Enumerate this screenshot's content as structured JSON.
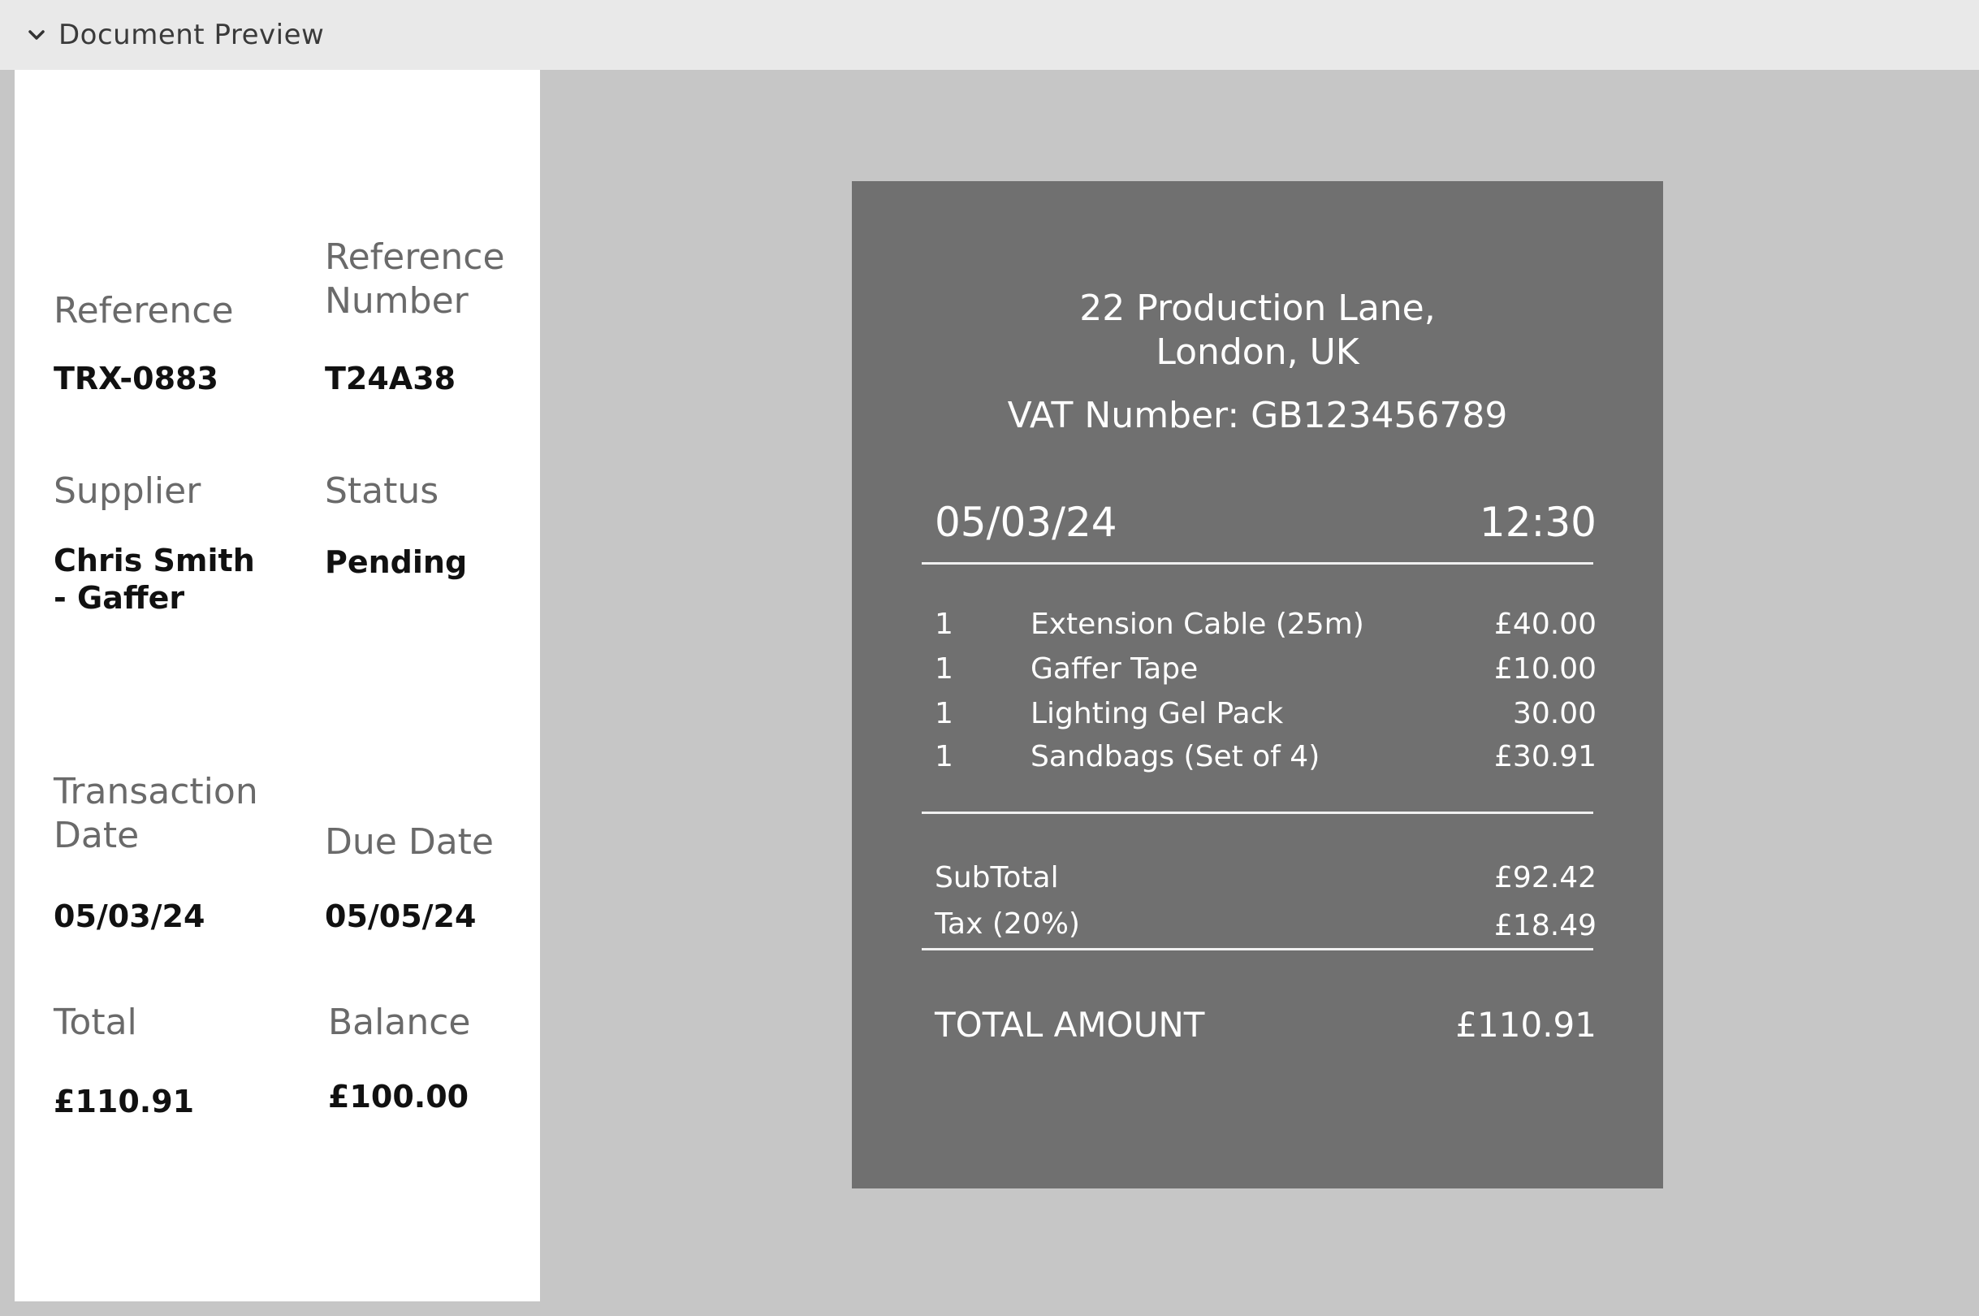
{
  "header": {
    "title": "Document Preview",
    "toggle_icon": "chevron-down-icon"
  },
  "details": {
    "reference": {
      "label": "Reference",
      "value": "TRX-0883"
    },
    "reference_number": {
      "label_line1": "Reference",
      "label_line2": "Number",
      "value": "T24A38"
    },
    "supplier": {
      "label": "Supplier",
      "value_line1": "Chris Smith",
      "value_line2": "- Gaffer"
    },
    "status": {
      "label": "Status",
      "value": "Pending"
    },
    "transaction_date": {
      "label_line1": "Transaction",
      "label_line2": "Date",
      "value": "05/03/24"
    },
    "due_date": {
      "label": "Due Date",
      "value": "05/05/24"
    },
    "total": {
      "label": "Total",
      "value": "£110.91"
    },
    "balance": {
      "label": "Balance",
      "value": "£100.00"
    }
  },
  "receipt": {
    "address_line1": "22 Production Lane,",
    "address_line2": "London, UK",
    "vat": "VAT Number: GB123456789",
    "date": "05/03/24",
    "time": "12:30",
    "items": [
      {
        "qty": "1",
        "desc": "Extension Cable (25m)",
        "price": "£40.00"
      },
      {
        "qty": "1",
        "desc": "Gaffer Tape",
        "price": "£10.00"
      },
      {
        "qty": "1",
        "desc": "Lighting Gel Pack",
        "price": "30.00"
      },
      {
        "qty": "1",
        "desc": "Sandbags (Set of 4)",
        "price": "£30.91"
      }
    ],
    "subtotal_label": "SubTotal",
    "subtotal": "£92.42",
    "tax_label": "Tax (20%)",
    "tax": "£18.49",
    "total_label": "TOTAL AMOUNT",
    "total": "£110.91"
  }
}
